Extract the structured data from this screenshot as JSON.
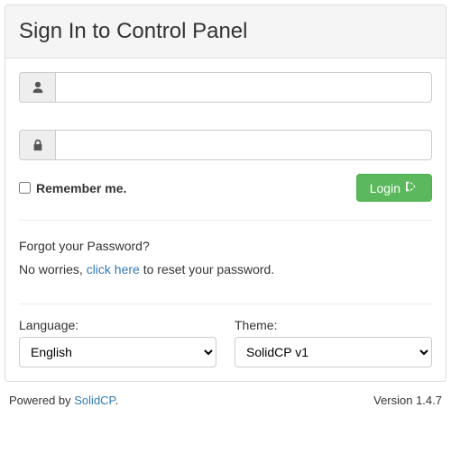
{
  "heading": "Sign In to Control Panel",
  "form": {
    "username": {
      "value": ""
    },
    "password": {
      "value": ""
    },
    "remember_label": "Remember me.",
    "login_button": "Login"
  },
  "forgot": {
    "title": "Forgot your Password?",
    "text_before": "No worries, ",
    "link_text": "click here",
    "text_after": " to reset your password."
  },
  "selects": {
    "language": {
      "label": "Language:",
      "selected": "English"
    },
    "theme": {
      "label": "Theme:",
      "selected": "SolidCP v1"
    }
  },
  "footer": {
    "powered_prefix": "Powered by ",
    "powered_link": "SolidCP",
    "powered_suffix": ".",
    "version": "Version 1.4.7"
  }
}
